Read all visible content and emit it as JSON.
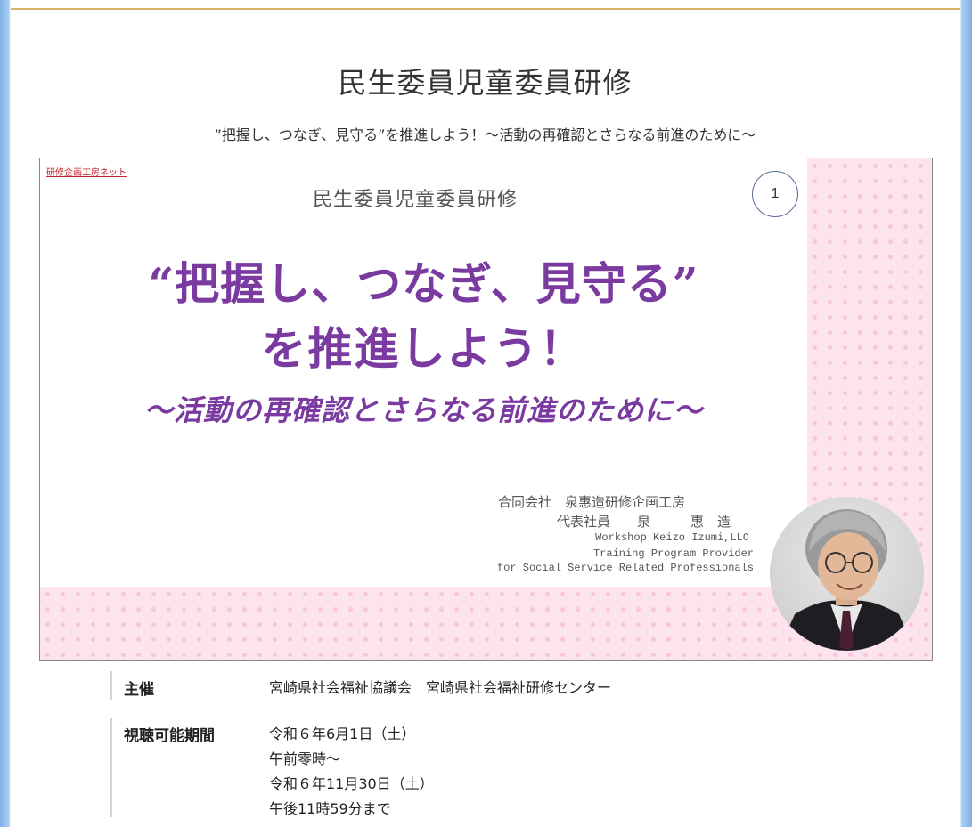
{
  "page": {
    "title": "民生委員児童委員研修",
    "subtitle": "”把握し、つなぎ、見守る”を推進しよう！～活動の再確認とさらなる前進のために～"
  },
  "slide": {
    "brand_link": "研修企画工房ネット",
    "heading": "民生委員児童委員研修",
    "page_number": "1",
    "headline_line1": "“把握し、つなぎ、見守る”",
    "headline_line2": "を推進しよう！",
    "headline_line3": "～活動の再確認とさらなる前進のために～",
    "company": "合同会社　泉惠造研修企画工房",
    "representative": "代表社員　　泉　　　惠　造",
    "english_lines": [
      "Workshop Keizo Izumi,LLC",
      "Training Program Provider",
      "for Social Service Related Professionals"
    ],
    "colors": {
      "headline": "#7a3aa0",
      "dots_background": "#fde3ee",
      "dot": "#f8c4d9"
    }
  },
  "details": {
    "organizer_label": "主催",
    "organizer_value": "宮崎県社会福祉協議会　宮崎県社会福祉研修センター",
    "period_label": "視聴可能期間",
    "period_lines": [
      "令和６年6月1日（土）",
      "午前零時～",
      "令和６年11月30日（土）",
      "午後11時59分まで"
    ]
  }
}
